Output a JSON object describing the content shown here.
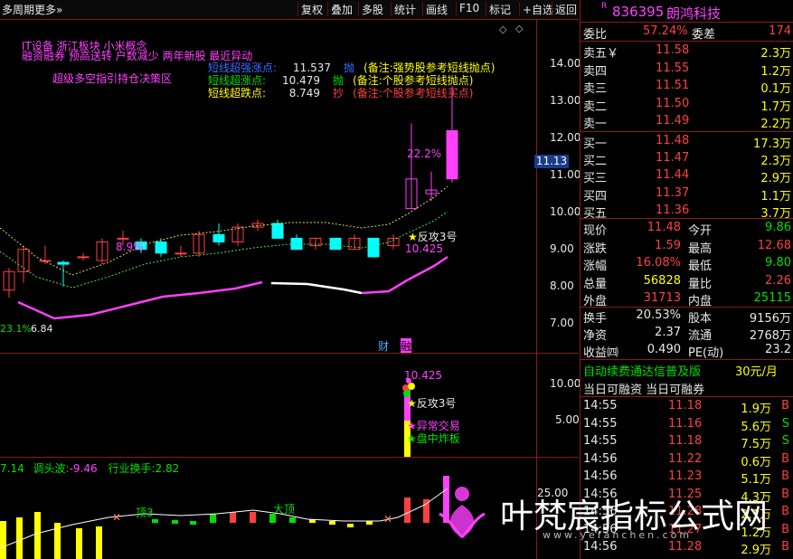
{
  "toolbar": {
    "period_label": "多周期",
    "more_label": "更多»",
    "buttons": [
      "复权",
      "叠加",
      "多股",
      "统计",
      "画线",
      "F10",
      "标记",
      "+自选",
      "返回"
    ]
  },
  "main_chart": {
    "header_line1": "IT设备  浙江板块  小米概念",
    "header_line2": "融资融券 预高送转 户数减少 两年新股 最近异动",
    "header_line3": "超级多空指引持仓决策区",
    "notes": [
      {
        "label": "短线超强涨点:",
        "value": "11.537",
        "tag": "抛",
        "note": "(备注:强势股参考短线抛点)",
        "color": "#3a6cff"
      },
      {
        "label": "短线超涨点:",
        "value": "10.479",
        "tag": "抛",
        "note": "(备注:个股参考短线抛点)",
        "color": "#00e000"
      },
      {
        "label": "短线超跌点:",
        "value": "8.749",
        "tag": "抄",
        "note": "(备注:个股参考短线买点)",
        "color": "#ffff00"
      }
    ],
    "y_ticks": [
      "14.00",
      "13.00",
      "12.00",
      "11.00",
      "10.00",
      "9.00",
      "8.00",
      "7.00"
    ],
    "price_tag": "11.13",
    "label_pct1": "8.9%",
    "label_pct2": "22.2%",
    "label_low": "23.1%",
    "label_low_val": "6.84",
    "label_fangong": "反攻3号",
    "label_fangong_val": "10.425",
    "cai": "财",
    "rong": "融"
  },
  "sub_chart1": {
    "y_ticks": [
      "10.00",
      "5.00"
    ],
    "value": "10.425",
    "tags": [
      "反攻3号",
      "异常交易",
      "盘中炸板"
    ]
  },
  "sub_chart2": {
    "header_prefix": "7.14",
    "label1": "调头波:",
    "value1": "-9.46",
    "label2": "行业换手:",
    "value2": "2.82",
    "y_tick": "25.00",
    "tag_bottom": "顶3",
    "tag_top": "大顶"
  },
  "quote": {
    "code": "836395",
    "name": "朗鸿科技",
    "weibi_label": "委比",
    "weibi_value": "57.24%",
    "weicha_label": "委差",
    "weicha_value": "174",
    "asks": [
      {
        "label": "卖五￥",
        "price": "11.58",
        "vol": "2.3万"
      },
      {
        "label": "卖四",
        "price": "11.55",
        "vol": "1.2万"
      },
      {
        "label": "卖三",
        "price": "11.51",
        "vol": "0.1万"
      },
      {
        "label": "卖二",
        "price": "11.50",
        "vol": "1.7万"
      },
      {
        "label": "卖一",
        "price": "11.49",
        "vol": "2.2万"
      }
    ],
    "bids": [
      {
        "label": "买一",
        "price": "11.48",
        "vol": "17.3万"
      },
      {
        "label": "买二",
        "price": "11.47",
        "vol": "2.3万"
      },
      {
        "label": "买三",
        "price": "11.44",
        "vol": "2.9万"
      },
      {
        "label": "买四",
        "price": "11.37",
        "vol": "1.1万"
      },
      {
        "label": "买五",
        "price": "11.36",
        "vol": "3.7万"
      }
    ],
    "stats": [
      {
        "l1": "现价",
        "v1": "11.48",
        "c1": "red",
        "l2": "今开",
        "v2": "9.86",
        "c2": "green"
      },
      {
        "l1": "涨跌",
        "v1": "1.59",
        "c1": "red",
        "l2": "最高",
        "v2": "12.68",
        "c2": "red"
      },
      {
        "l1": "涨幅",
        "v1": "16.08%",
        "c1": "red",
        "l2": "最低",
        "v2": "9.80",
        "c2": "green"
      },
      {
        "l1": "总量",
        "v1": "56828",
        "c1": "yellow",
        "l2": "量比",
        "v2": "2.26",
        "c2": "red"
      },
      {
        "l1": "外盘",
        "v1": "31713",
        "c1": "red",
        "l2": "内盘",
        "v2": "25115",
        "c2": "green"
      }
    ],
    "stats2": [
      {
        "l1": "换手",
        "v1": "20.53%",
        "l2": "股本",
        "v2": "9156万"
      },
      {
        "l1": "净资",
        "v1": "2.37",
        "l2": "流通",
        "v2": "2768万"
      },
      {
        "l1": "收益㈣",
        "v1": "0.490",
        "l2": "PE(动)",
        "v2": "23.2"
      }
    ],
    "ad_text": "自动续费通达信普及版",
    "ad_price": "30元/月",
    "rongzi_label": "当日可融资 当日可融券",
    "ticks": [
      {
        "t": "14:55",
        "p": "11.18",
        "v": "1.9万",
        "s": "B"
      },
      {
        "t": "14:55",
        "p": "11.16",
        "v": "5.6万",
        "s": "S"
      },
      {
        "t": "14:55",
        "p": "11.18",
        "v": "7.5万",
        "s": "S"
      },
      {
        "t": "14:56",
        "p": "11.22",
        "v": "0.6万",
        "s": "B"
      },
      {
        "t": "14:56",
        "p": "11.23",
        "v": "5.1万",
        "s": "B"
      },
      {
        "t": "14:56",
        "p": "11.25",
        "v": "4.3万",
        "s": "B"
      },
      {
        "t": "14:56",
        "p": "11.28",
        "v": "2.1万",
        "s": "B"
      },
      {
        "t": "14:56",
        "p": "11.27",
        "v": "1.2万",
        "s": "B"
      },
      {
        "t": "14:56",
        "p": "11.28",
        "v": "2.9万",
        "s": "B"
      }
    ]
  },
  "watermark": {
    "main": "叶梵宸指标公式网",
    "sub": "www.yefanchen.com"
  }
}
